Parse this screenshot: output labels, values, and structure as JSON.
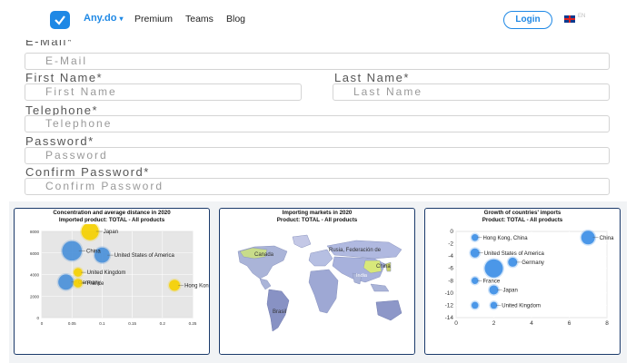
{
  "header": {
    "brand": "Any.do",
    "brand_chevron": "chevron-down",
    "nav": [
      "Premium",
      "Teams",
      "Blog"
    ],
    "login_label": "Login",
    "language": "EN",
    "accent": "#1e88e5"
  },
  "form": {
    "email": {
      "label": "E-Mail*",
      "placeholder": "E-Mail"
    },
    "first_name": {
      "label": "First Name*",
      "placeholder": "First Name"
    },
    "last_name": {
      "label": "Last Name*",
      "placeholder": "Last Name"
    },
    "telephone": {
      "label": "Telephone*",
      "placeholder": "Telephone"
    },
    "password": {
      "label": "Password*",
      "placeholder": "Password"
    },
    "confirm_password": {
      "label": "Confirm Password*",
      "placeholder": "Confirm Password"
    }
  },
  "charts": {
    "panel1": {
      "title_line1": "Concentration and average distance in 2020",
      "title_line2": "Imported product: TOTAL - All products"
    },
    "panel2": {
      "title_line1": "Importing markets in 2020",
      "title_line2": "Product: TOTAL - All products"
    },
    "panel3": {
      "title_line1": "Growth of countries' imports",
      "title_line2": "Product: TOTAL - All products"
    }
  },
  "chart_data": [
    {
      "type": "scatter",
      "title": "Concentration and average distance in 2020",
      "subtitle": "Imported product: TOTAL - All products",
      "xlim": [
        0,
        0.25
      ],
      "ylim": [
        0,
        8000
      ],
      "x_ticks": [
        "0",
        "0.05",
        "0.1",
        "0.15",
        "0.2",
        "0.25"
      ],
      "y_ticks": [
        "0",
        "2000",
        "4000",
        "6000",
        "8000"
      ],
      "points": [
        {
          "label": "Japan",
          "x": 0.08,
          "y": 8000,
          "size": 8,
          "color": "#f5d000"
        },
        {
          "label": "United States of America",
          "x": 0.1,
          "y": 5800,
          "size": 7,
          "color": "#4a90d9"
        },
        {
          "label": "China",
          "x": 0.05,
          "y": 6200,
          "size": 9,
          "color": "#4a90d9"
        },
        {
          "label": "United Kingdom",
          "x": 0.06,
          "y": 4200,
          "size": 4,
          "color": "#f5d000"
        },
        {
          "label": "Germany",
          "x": 0.04,
          "y": 3300,
          "size": 7,
          "color": "#4a90d9"
        },
        {
          "label": "France",
          "x": 0.06,
          "y": 3200,
          "size": 4,
          "color": "#f5d000"
        },
        {
          "label": "Hong Kong, China",
          "x": 0.22,
          "y": 3000,
          "size": 5,
          "color": "#f5d000"
        }
      ]
    },
    {
      "type": "map",
      "title": "Importing markets in 2020",
      "subtitle": "Product: TOTAL - All products",
      "labels": [
        "Canada",
        "Rusia, Federación de",
        "China",
        "India",
        "Brasil"
      ]
    },
    {
      "type": "scatter",
      "title": "Growth of countries' imports",
      "subtitle": "Product: TOTAL - All products",
      "xlim": [
        0,
        8
      ],
      "ylim": [
        -14,
        0
      ],
      "x_ticks": [
        "0",
        "2",
        "4",
        "6",
        "8"
      ],
      "y_ticks": [
        "0",
        "-2",
        "-4",
        "-6",
        "-8",
        "-10",
        "-12",
        "-14"
      ],
      "points": [
        {
          "label": "Hong Kong, China",
          "x": 1,
          "y": -1,
          "size": 3
        },
        {
          "label": "China",
          "x": 7,
          "y": -1,
          "size": 6
        },
        {
          "label": "United States of America",
          "x": 1,
          "y": -3.5,
          "size": 4
        },
        {
          "label": "Germany",
          "x": 3,
          "y": -5,
          "size": 4
        },
        {
          "label": "",
          "x": 2,
          "y": -6,
          "size": 8
        },
        {
          "label": "France",
          "x": 1,
          "y": -8,
          "size": 3
        },
        {
          "label": "Japan",
          "x": 2,
          "y": -9.5,
          "size": 4
        },
        {
          "label": "United Kingdom",
          "x": 2,
          "y": -12,
          "size": 3
        },
        {
          "label": "",
          "x": 1,
          "y": -12,
          "size": 3
        }
      ]
    }
  ]
}
